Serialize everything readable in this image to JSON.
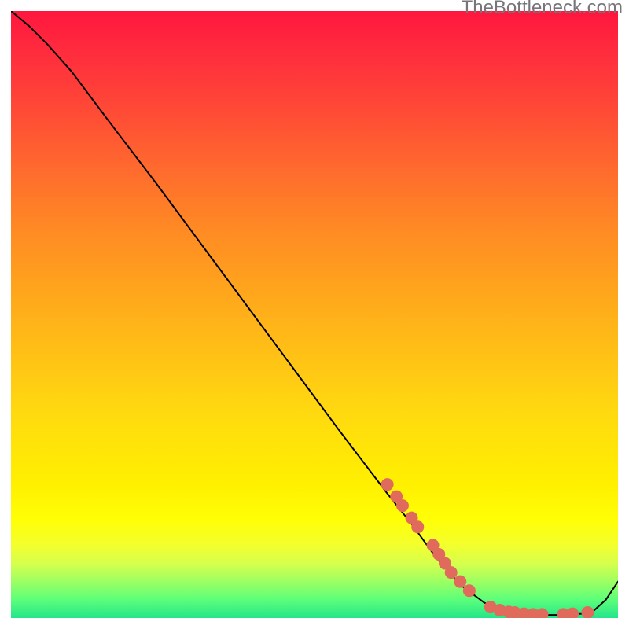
{
  "watermark": "TheBottleneck.com",
  "chart_data": {
    "type": "line",
    "title": "",
    "xlabel": "",
    "ylabel": "",
    "xlim": [
      0,
      100
    ],
    "ylim": [
      0,
      100
    ],
    "line": {
      "color": "#000000",
      "width": 2,
      "points": [
        {
          "x": 0,
          "y": 100
        },
        {
          "x": 3,
          "y": 97.5
        },
        {
          "x": 6,
          "y": 94.5
        },
        {
          "x": 10,
          "y": 90
        },
        {
          "x": 16,
          "y": 82
        },
        {
          "x": 24,
          "y": 71.5
        },
        {
          "x": 34,
          "y": 58
        },
        {
          "x": 44,
          "y": 44.5
        },
        {
          "x": 54,
          "y": 31
        },
        {
          "x": 62,
          "y": 20.5
        },
        {
          "x": 66,
          "y": 15.5
        },
        {
          "x": 70,
          "y": 10
        },
        {
          "x": 74,
          "y": 5.5
        },
        {
          "x": 78,
          "y": 2.5
        },
        {
          "x": 82,
          "y": 1
        },
        {
          "x": 86,
          "y": 0.5
        },
        {
          "x": 90,
          "y": 0.5
        },
        {
          "x": 94,
          "y": 0.7
        },
        {
          "x": 96,
          "y": 1.2
        },
        {
          "x": 98,
          "y": 3.0
        },
        {
          "x": 100,
          "y": 6.0
        }
      ]
    },
    "dots": {
      "color": "#e06a5c",
      "radius": 8,
      "points": [
        {
          "x": 62,
          "y": 22
        },
        {
          "x": 63.5,
          "y": 20
        },
        {
          "x": 64.5,
          "y": 18.5
        },
        {
          "x": 66,
          "y": 16.5
        },
        {
          "x": 67,
          "y": 15
        },
        {
          "x": 69.5,
          "y": 12
        },
        {
          "x": 70.5,
          "y": 10.5
        },
        {
          "x": 71.5,
          "y": 9
        },
        {
          "x": 72.5,
          "y": 7.5
        },
        {
          "x": 74,
          "y": 6
        },
        {
          "x": 75.5,
          "y": 4.5
        },
        {
          "x": 79,
          "y": 1.8
        },
        {
          "x": 80.5,
          "y": 1.3
        },
        {
          "x": 82,
          "y": 1.0
        },
        {
          "x": 83,
          "y": 0.9
        },
        {
          "x": 84.5,
          "y": 0.7
        },
        {
          "x": 86,
          "y": 0.6
        },
        {
          "x": 87.5,
          "y": 0.6
        },
        {
          "x": 91,
          "y": 0.6
        },
        {
          "x": 92.5,
          "y": 0.7
        },
        {
          "x": 95,
          "y": 0.9
        }
      ]
    }
  }
}
